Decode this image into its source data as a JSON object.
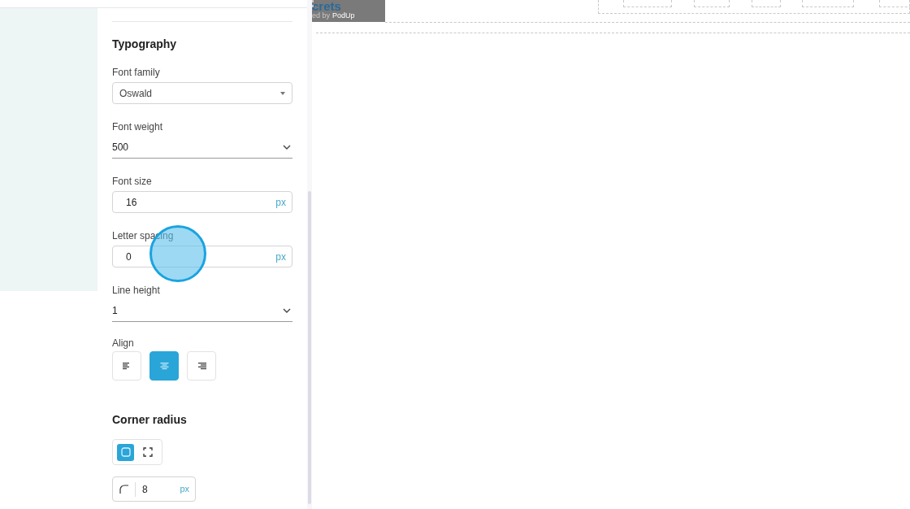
{
  "canvas_header": {
    "logo_text": "crets",
    "tagline_prefix": "ed by",
    "tagline_brand": "PodUp"
  },
  "typography": {
    "title": "Typography",
    "fields": [
      {
        "kind": "select",
        "label": "Font family",
        "value": "Oswald"
      },
      {
        "kind": "underline",
        "label": "Font weight",
        "value": "500"
      },
      {
        "kind": "unit",
        "label": "Font size",
        "value": "16",
        "unit": "px"
      },
      {
        "kind": "unit",
        "label": "Letter spacing",
        "value": "0",
        "unit": "px"
      },
      {
        "kind": "underline",
        "label": "Line height",
        "value": "1"
      }
    ]
  },
  "align": {
    "label": "Align",
    "options": [
      {
        "kind": "left",
        "selected": false
      },
      {
        "kind": "center",
        "selected": true
      },
      {
        "kind": "right",
        "selected": false
      }
    ]
  },
  "corner_radius": {
    "title": "Corner radius",
    "modes": [
      {
        "kind": "uniform",
        "selected": true
      },
      {
        "kind": "individual",
        "selected": false
      }
    ],
    "value": "8",
    "unit": "px"
  }
}
